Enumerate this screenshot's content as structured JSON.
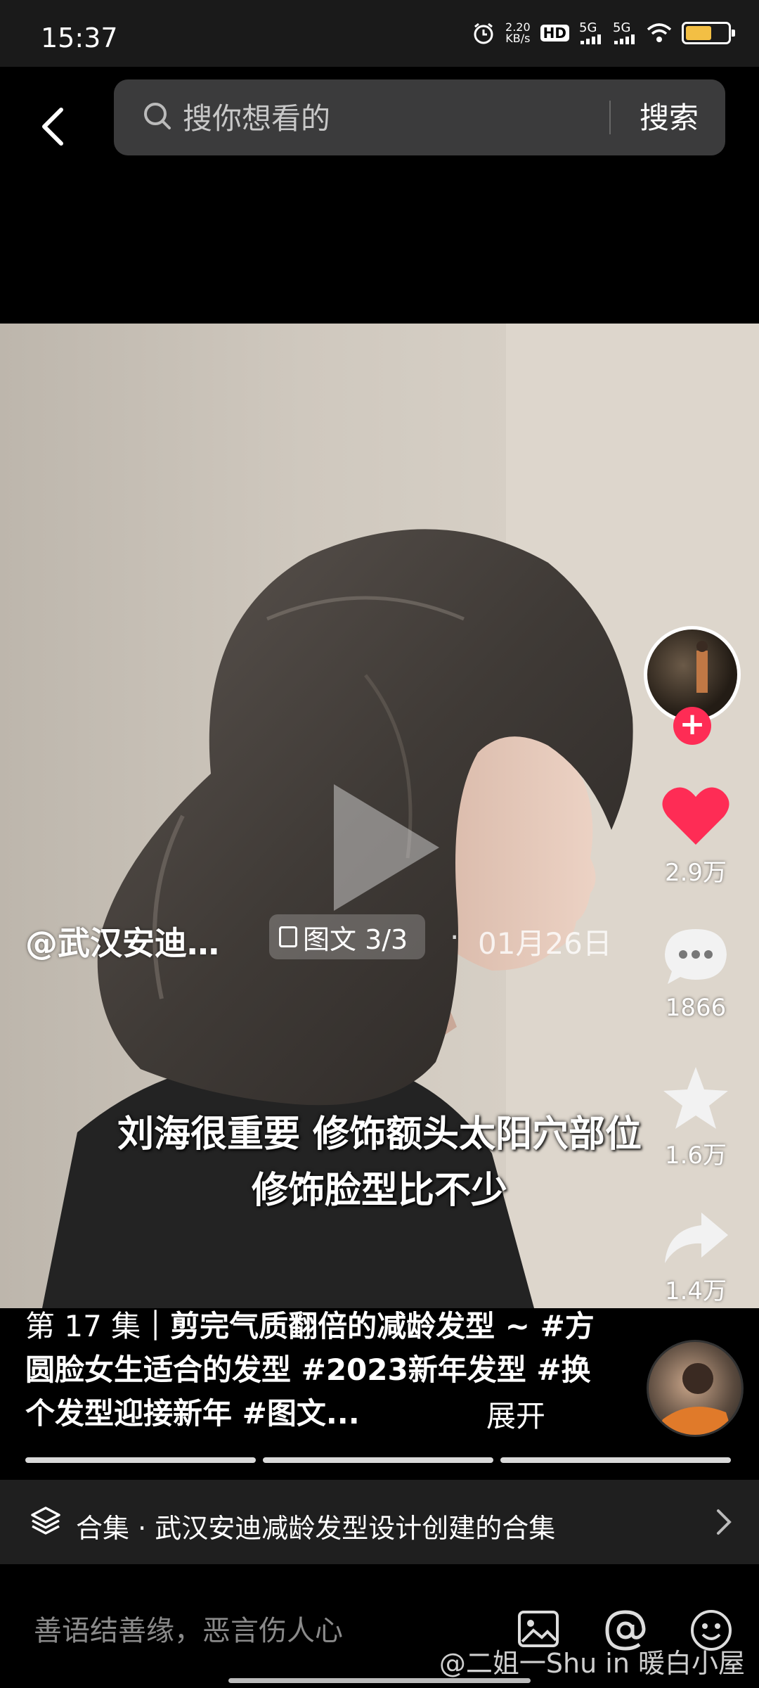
{
  "status_bar": {
    "time": "15:37",
    "net_speed_value": "2.20",
    "net_speed_unit": "KB/s",
    "hd_label": "HD",
    "signal1": "5G",
    "signal2": "5G"
  },
  "search": {
    "placeholder": "搜你想看的",
    "button_label": "搜索"
  },
  "media": {
    "subtitle_line1": "刘海很重要 修饰额头太阳穴部位",
    "subtitle_line2": "修饰脸型比不少",
    "author": "@武汉安迪…",
    "type_label": "图文 3/3",
    "date": "01月26日"
  },
  "rail": {
    "likes": "2.9万",
    "comments": "1866",
    "favorites": "1.6万",
    "shares": "1.4万"
  },
  "caption": {
    "episode": "第 17 集",
    "text": "｜剪完气质翻倍的减龄发型 ~ #方圆脸女生适合的发型 #2023新年发型 #换个发型迎接新年 #图文...",
    "expand": "展开"
  },
  "collection": {
    "label": "合集 · 武汉安迪减龄发型设计创建的合集"
  },
  "comment_bar": {
    "placeholder": "善语结善缘，恶言伤人心",
    "watermark": "@二姐一Shu in 暖白小屋"
  },
  "colors": {
    "accent": "#fe2c55",
    "like": "#fe2c55",
    "battery": "#f3bf44"
  }
}
